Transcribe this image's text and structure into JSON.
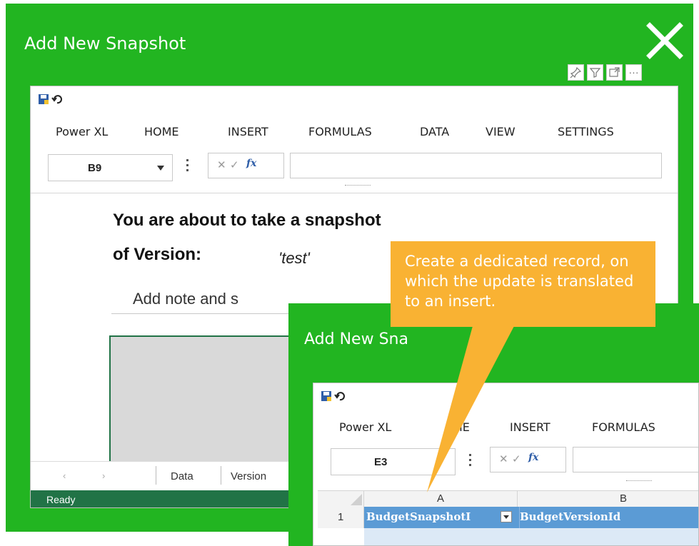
{
  "dialog": {
    "title": "Add New Snapshot",
    "ribbon_tabs": [
      "Power XL",
      "HOME",
      "INSERT",
      "FORMULAS",
      "DATA",
      "VIEW",
      "SETTINGS"
    ],
    "name_box": "B9",
    "fx_label": "fx",
    "sheet": {
      "line1": "You are about to take a snapshot",
      "line2_label": "of Version:",
      "version_value": "'test'",
      "note_text": "Add note and s"
    },
    "sheet_tabs": [
      "Data",
      "Version"
    ],
    "status": "Ready"
  },
  "callout": {
    "text": "Create a dedicated record, on which the update is translated to an insert."
  },
  "dialog2": {
    "title": "Add New Sna",
    "ribbon_tabs": [
      "Power XL",
      "ME",
      "INSERT",
      "FORMULAS"
    ],
    "name_box": "E3",
    "fx_label": "fx",
    "columns": [
      "A",
      "B"
    ],
    "row_number": "1",
    "cells": [
      "BudgetSnapshotI",
      "BudgetVersionId"
    ]
  },
  "colors": {
    "dialog_green": "#22b521",
    "callout_orange": "#f9b233",
    "status_green": "#217346",
    "header_blue": "#5b9bd5"
  }
}
